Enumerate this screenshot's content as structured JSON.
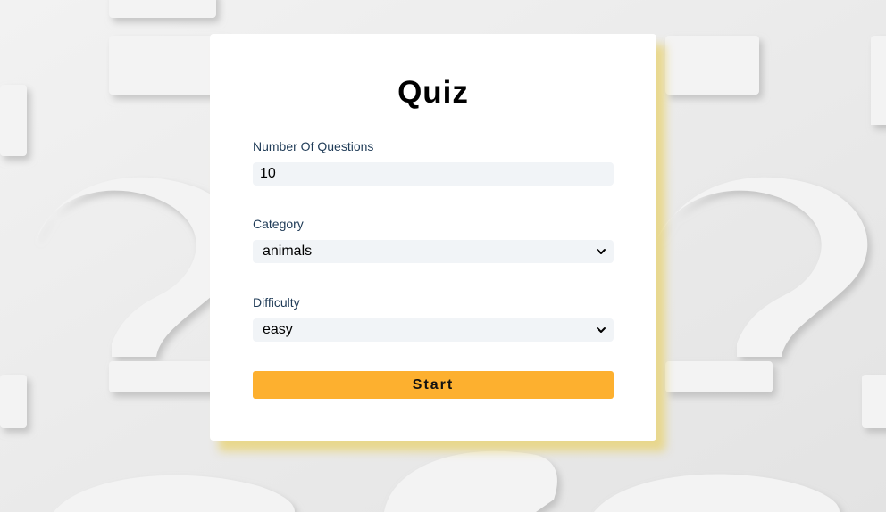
{
  "quiz": {
    "title": "Quiz",
    "questions_label": "Number Of Questions",
    "questions_value": "10",
    "category_label": "Category",
    "category_value": "animals",
    "difficulty_label": "Difficulty",
    "difficulty_value": "easy",
    "start_label": "Start"
  },
  "colors": {
    "accent": "#fdb02f",
    "field_bg": "#f1f4f7",
    "label_text": "#1f3b57",
    "shadow": "#e8d26e"
  },
  "icons": {
    "select_arrow": "chevron-down-icon",
    "background_motif": "question-mark-icon"
  }
}
